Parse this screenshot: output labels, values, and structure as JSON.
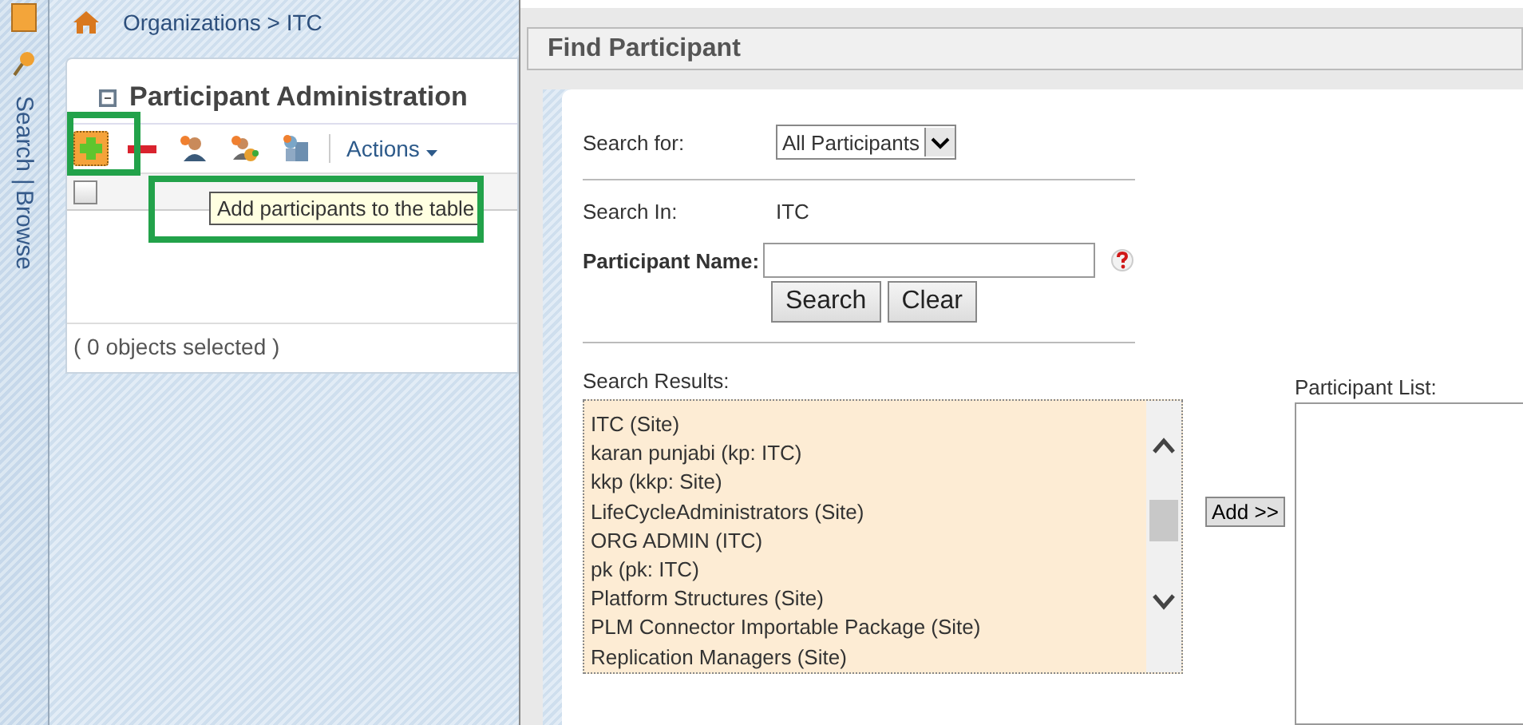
{
  "sidebar": {
    "links": [
      "Search",
      "|",
      "Browse"
    ]
  },
  "breadcrumb": "Organizations > ITC",
  "panel": {
    "title": "Participant Administration",
    "toolbar": [
      {
        "kind": "add",
        "highlighted": true
      },
      {
        "kind": "remove",
        "highlighted": false
      },
      {
        "kind": "user",
        "highlighted": false
      },
      {
        "kind": "user-group",
        "highlighted": false
      },
      {
        "kind": "org",
        "highlighted": false
      }
    ],
    "actions_menu": "Actions",
    "header_checkbox": {
      "checked": false
    },
    "tooltip": "Add participants to the table",
    "footer": "( 0 objects selected )"
  },
  "dialog": {
    "title": "Find Participant",
    "search_for": {
      "label": "Search for:",
      "value": "All Participants"
    },
    "search_in": {
      "label": "Search In:",
      "value": "ITC"
    },
    "participant_name": {
      "label": "Participant Name:"
    },
    "buttons": [
      "Search",
      "Clear"
    ],
    "results_label": "Search Results:",
    "results": [
      "ITC (Site)",
      "karan punjabi (kp: ITC)",
      "kkp (kkp: Site)",
      "LifeCycleAdministrators (Site)",
      "ORG ADMIN (ITC)",
      "pk (pk: ITC)",
      "Platform Structures (Site)",
      "PLM Connector Importable Package (Site)",
      "Replication Managers (Site)"
    ],
    "add_button": "Add >>",
    "participant_list_label": "Participant List:"
  }
}
